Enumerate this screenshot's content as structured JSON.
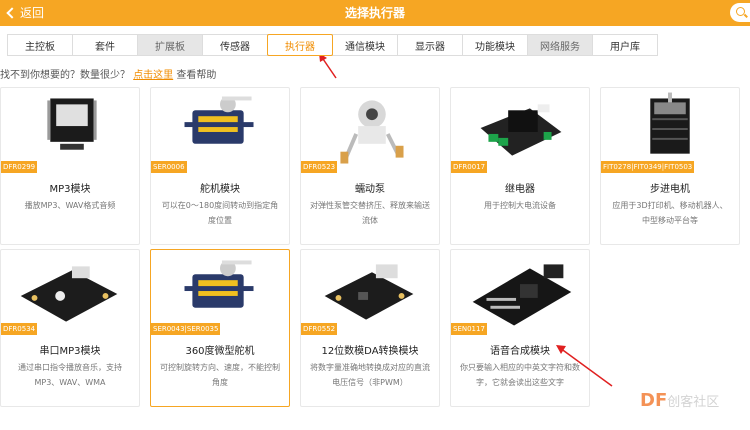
{
  "header": {
    "back_label": "返回",
    "title": "选择执行器"
  },
  "tabs": [
    {
      "label": "主控板",
      "state": "normal"
    },
    {
      "label": "套件",
      "state": "normal"
    },
    {
      "label": "扩展板",
      "state": "gray"
    },
    {
      "label": "传感器",
      "state": "normal"
    },
    {
      "label": "执行器",
      "state": "active"
    },
    {
      "label": "通信模块",
      "state": "normal"
    },
    {
      "label": "显示器",
      "state": "normal"
    },
    {
      "label": "功能模块",
      "state": "normal"
    },
    {
      "label": "网络服务",
      "state": "gray"
    },
    {
      "label": "用户库",
      "state": "normal"
    }
  ],
  "hint": {
    "prefix": "找不到你想要的？数量很少？",
    "link": "点击这里",
    "suffix": "查看帮助"
  },
  "cards": [
    {
      "name": "MP3模块",
      "sku": "DFR0299",
      "desc": "播放MP3、WAV格式音频",
      "icon": "mp3-module-icon"
    },
    {
      "name": "舵机模块",
      "sku": "SER0006",
      "desc": "可以在0～180度间转动到指定角度位置",
      "icon": "servo-icon"
    },
    {
      "name": "蠕动泵",
      "sku": "DFR0523",
      "desc": "对弹性泵管交替挤压、释放来输送流体",
      "icon": "pump-icon"
    },
    {
      "name": "继电器",
      "sku": "DFR0017",
      "desc": "用于控制大电流设备",
      "icon": "relay-icon"
    },
    {
      "name": "步进电机",
      "sku": "FIT0278|FIT0349|FIT0503",
      "desc": "应用于3D打印机、移动机器人、中型移动平台等",
      "icon": "stepper-motor-icon"
    },
    {
      "name": "串口MP3模块",
      "sku": "DFR0534",
      "desc": "通过串口指令播放音乐，支持MP3、WAV、WMA",
      "icon": "serial-mp3-icon"
    },
    {
      "name": "360度微型舵机",
      "sku": "SER0043|SER0035",
      "desc": "可控制旋转方向、速度，不能控制角度",
      "icon": "micro-servo-icon"
    },
    {
      "name": "12位数模DA转换模块",
      "sku": "DFR0552",
      "desc": "将数字量准确地转换成对应的直流电压信号（非PWM）",
      "icon": "dac-module-icon"
    },
    {
      "name": "语音合成模块",
      "sku": "SEN0117",
      "desc": "你只要输入相应的中英文字符和数字，它就会读出这些文字",
      "icon": "speech-synthesis-icon"
    }
  ],
  "watermark": {
    "brand": "DF",
    "text": "创客社区"
  },
  "colors": {
    "accent": "#f6a623",
    "link": "#f08c00",
    "arrow": "#e02020"
  }
}
